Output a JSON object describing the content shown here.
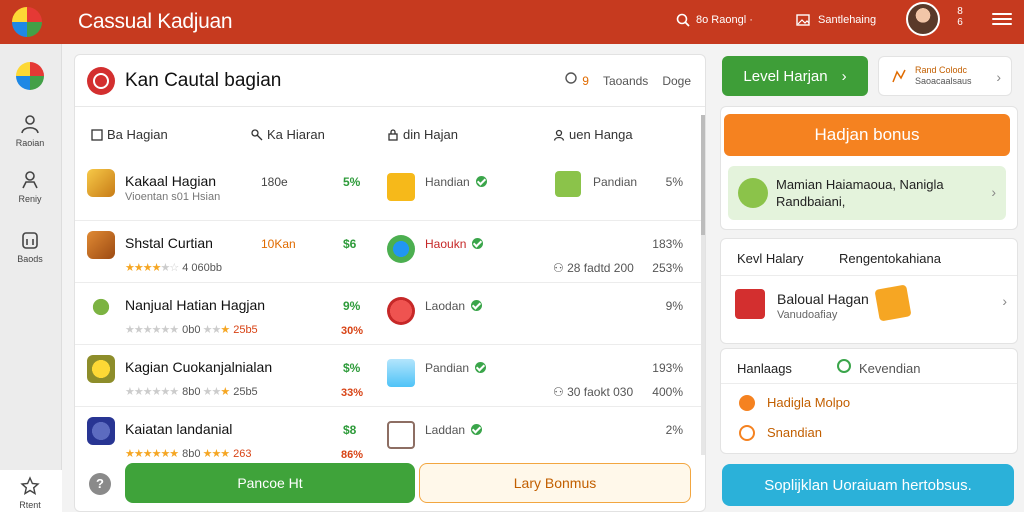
{
  "app": {
    "title": "Cassual Kadjuan"
  },
  "topbar": {
    "search_label": "8o Raongl ·",
    "filter_label": "Santlehaing",
    "count": "8",
    "count_sub": "6"
  },
  "rail": {
    "items": [
      {
        "label": "Raoian",
        "icon": "person-icon"
      },
      {
        "label": "Reniy",
        "icon": "person-outline-icon"
      },
      {
        "label": "Baods",
        "icon": "building-icon"
      }
    ],
    "bottom_label": "Rtent"
  },
  "main": {
    "title": "Kan Cautal bagian",
    "header_right": [
      "Taoands",
      "Doge"
    ],
    "header_badge": "9",
    "columns": [
      "Ba Hagian",
      "Ka Hiaran",
      "din Hajan",
      "uen Hanga"
    ],
    "rows": [
      {
        "name": "Kakaal Hagian",
        "sub": "Vioentan s01 Hsian",
        "mid": "180e",
        "pct": "5%",
        "status": "Handian",
        "status_red": false,
        "right": "5%",
        "right2": "",
        "right_mid": "",
        "stars": 0,
        "stars_value": "",
        "stars2_value": "",
        "pct2": "",
        "right_label": "Pandian"
      },
      {
        "name": "Shstal Curtian",
        "sub": "",
        "mid": "10Kan",
        "mid_orange": true,
        "pct": "$6",
        "status": "Haoukn",
        "status_red": true,
        "right": "183%",
        "right2": "253%",
        "right_mid": "28 fadtd 200",
        "stars": 4,
        "stars_value": "4 060bb",
        "stars2_value": "",
        "pct2": "",
        "right_label": ""
      },
      {
        "name": "Nanjual Hatian Hagjan",
        "sub": "",
        "mid": "",
        "pct": "9%",
        "status": "Laodan",
        "status_red": false,
        "right": "9%",
        "right2": "",
        "right_mid": "",
        "stars": 0,
        "stars_value": "0b0",
        "stars2_value": "25b5",
        "pct2": "30%",
        "right_label": ""
      },
      {
        "name": "Kagian Cuokanjalnialan",
        "sub": "",
        "mid": "",
        "pct": "$%",
        "status": "Pandian",
        "status_red": false,
        "right": "193%",
        "right2": "400%",
        "right_mid": "30 faokt 030",
        "stars": 0,
        "stars_value": "8b0",
        "stars2_value": "25b5",
        "pct2": "33%",
        "right_label": ""
      },
      {
        "name": "Kaiatan landanial",
        "sub": "",
        "mid": "",
        "pct": "$8",
        "status": "Laddan",
        "status_red": false,
        "right": "2%",
        "right2": "",
        "right_mid": "",
        "stars": 5,
        "stars_value": "8b0",
        "stars2_value": "263",
        "pct2": "86%",
        "right_label": ""
      }
    ],
    "btn_primary": "Pancoe Ht",
    "btn_secondary": "Lary  Bonmus"
  },
  "right": {
    "level_btn": "Level Harjan",
    "top_card_line1": "Rand Colodc",
    "top_card_line2": "Saoacaalsaus",
    "bonus_btn": "Hadjan bonus",
    "promo_line1": "Mamian Haiamaoua, Nanigla",
    "promo_line2": "Randbaiani,",
    "section2_left": "Kevl Halary",
    "section2_right": "Rengentokahiana",
    "item_title": "Baloual Hagan",
    "item_sub": "Vanudoafiay",
    "section3_left": "Hanlaags",
    "section3_right": "Kevendian",
    "list": [
      "Hadigla Molpo",
      "Snandian"
    ],
    "bottom_btn": "Soplijklan Uoraiuam hertobsus."
  },
  "colors": {
    "topbar": "#c63a1f",
    "primary_green": "#3fa33a",
    "accent_orange": "#f58220",
    "accent_blue": "#2bb1d9"
  }
}
